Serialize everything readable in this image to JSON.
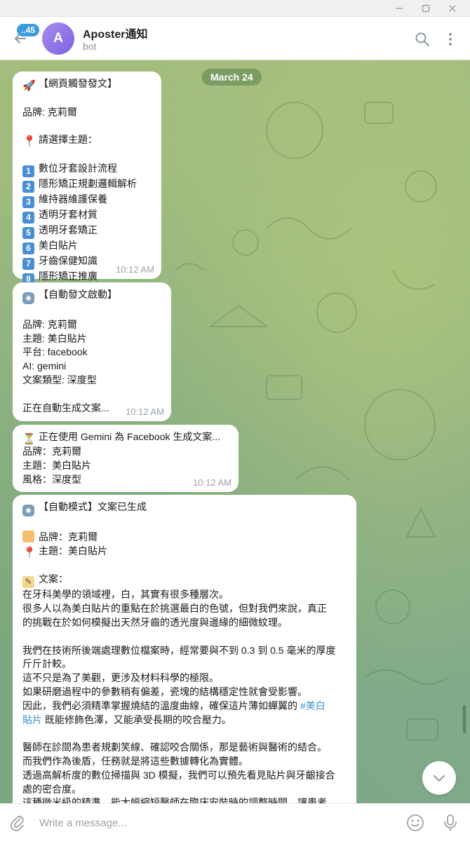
{
  "header": {
    "unread_count": "..45",
    "avatar_letter": "A",
    "title": "Aposter通知",
    "subtitle": "bot"
  },
  "chat": {
    "date": "March 24",
    "messages": [
      {
        "time": "10:12 AM",
        "lines": [
          {
            "icon": "rocket-icon",
            "text": "【網頁觸發發文】"
          },
          {
            "text": ""
          },
          {
            "text": "品牌: 克莉爾"
          },
          {
            "text": ""
          },
          {
            "icon": "pin-icon",
            "text": "請選擇主題："
          },
          {
            "text": ""
          },
          {
            "icon": "keycap-1-icon",
            "text": "數位牙套設計流程"
          },
          {
            "icon": "keycap-2-icon",
            "text": "隱形矯正規劃邏輯解析"
          },
          {
            "icon": "keycap-3-icon",
            "text": "維持器維護保養"
          },
          {
            "icon": "keycap-4-icon",
            "text": "透明牙套材質"
          },
          {
            "icon": "keycap-5-icon",
            "text": "透明牙套矯正"
          },
          {
            "icon": "keycap-6-icon",
            "text": "美白貼片"
          },
          {
            "icon": "keycap-7-icon",
            "text": "牙齒保健知識"
          },
          {
            "icon": "keycap-8-icon",
            "text": "隱形矯正推廣"
          }
        ]
      },
      {
        "time": "10:12 AM",
        "lines": [
          {
            "icon": "robot-icon",
            "text": "【自動發文啟動】"
          },
          {
            "text": ""
          },
          {
            "text": "品牌: 克莉爾"
          },
          {
            "text": "主題: 美白貼片"
          },
          {
            "text": "平台: facebook"
          },
          {
            "text": "AI: gemini"
          },
          {
            "text": "文案類型: 深度型"
          },
          {
            "text": ""
          },
          {
            "text": "正在自動生成文案..."
          }
        ]
      },
      {
        "time": "10:12 AM",
        "lines": [
          {
            "icon": "hourglass-icon",
            "text": "正在使用 Gemini 為 Facebook 生成文案..."
          },
          {
            "text": "品牌：克莉爾"
          },
          {
            "text": "主題：美白貼片"
          },
          {
            "text": "風格：深度型"
          }
        ]
      },
      {
        "lines": [
          {
            "icon": "robot-icon",
            "text": "【自動模式】文案已生成"
          },
          {
            "text": ""
          },
          {
            "icon": "label-tag-icon",
            "text": "品牌：克莉爾"
          },
          {
            "icon": "pin-icon",
            "text": "主題：美白貼片"
          },
          {
            "text": ""
          },
          {
            "icon": "memo-icon",
            "text": "文案："
          },
          {
            "text": "在牙科美學的領域裡，白，其實有很多種層次。"
          },
          {
            "text": "很多人以為美白貼片的重點在於挑選最白的色號，但對我們來說，真正"
          },
          {
            "text": "的挑戰在於如何模擬出天然牙齒的透光度與邊緣的細微紋理。"
          },
          {
            "text": ""
          },
          {
            "text": "我們在技術所後端處理數位檔案時，經常要與不到 0.3 到 0.5 毫米的厚度"
          },
          {
            "text": "斤斤計較。"
          },
          {
            "text": "這不只是為了美觀，更涉及材料科學的極限。"
          },
          {
            "text": "如果研磨過程中的參數稍有偏差，瓷塊的結構穩定性就會受影響。"
          },
          {
            "text": "因此，我們必須精準掌握燒結的溫度曲線，確保這片薄如蟬翼的 ",
            "hashtag": "#美白"
          },
          {
            "hashtag": "貼片",
            "text": " 既能修飾色澤，又能承受長期的咬合壓力。"
          },
          {
            "text": ""
          },
          {
            "text": "醫師在診間為患者規劃笑線、確認咬合關係，那是藝術與醫術的結合。"
          },
          {
            "text": "而我們作為後盾，任務就是將這些數據轉化為實體。"
          },
          {
            "text": "透過高解析度的數位掃描與 3D 模擬，我們可以預先看見貼片與牙齦接合"
          },
          {
            "text": "處的密合度。"
          },
          {
            "text": "這種微米級的精準，能大幅縮短醫師在臨床安裝時的調整時間，讓患者"
          }
        ]
      }
    ]
  },
  "composer": {
    "placeholder": "Write a message..."
  },
  "colors": {
    "accent": "#3a9bdc",
    "avatar": "#8f76e8",
    "hashtag": "#3a8fd0",
    "background": "#98b882"
  }
}
